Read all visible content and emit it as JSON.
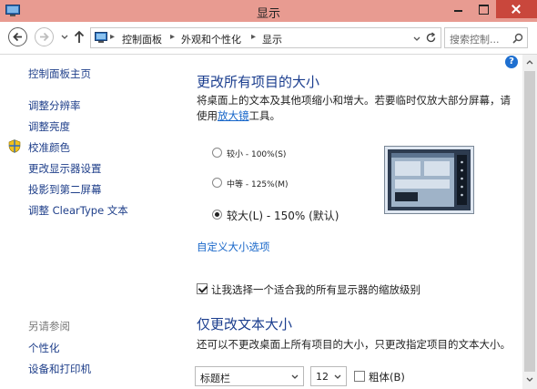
{
  "window": {
    "title": "显示"
  },
  "nav": {
    "breadcrumbs": [
      "控制面板",
      "外观和个性化",
      "显示"
    ],
    "search_placeholder": "搜索控制...",
    "icons": [
      "back-arrow-icon",
      "forward-arrow-icon",
      "chevron-down-icon",
      "up-arrow-icon",
      "refresh-icon",
      "search-icon"
    ]
  },
  "sidebar": {
    "home": "控制面板主页",
    "links": [
      "调整分辨率",
      "调整亮度",
      "校准颜色",
      "更改显示器设置",
      "投影到第二屏幕",
      "调整 ClearType 文本"
    ],
    "see_also_heading": "另请参阅",
    "see_also": [
      "个性化",
      "设备和打印机"
    ]
  },
  "main": {
    "heading": "更改所有项目的大小",
    "desc_line1": "将桌面上的文本及其他项缩小和增大。若要临时仅放大部分屏幕，请",
    "desc_prefix": "使用",
    "desc_link": "放大镜",
    "desc_suffix": "工具。",
    "options": [
      {
        "label": "较小 - 100%(S)",
        "checked": false
      },
      {
        "label": "中等 - 125%(M)",
        "checked": false
      },
      {
        "label": "较大(L) - 150% (默认)",
        "checked": true
      }
    ],
    "custom_link": "自定义大小选项",
    "scale_checkbox": {
      "label": "让我选择一个适合我的所有显示器的缩放级别",
      "checked": true
    },
    "text_heading": "仅更改文本大小",
    "text_desc": "还可以不更改桌面上所有项目的大小，只更改指定项目的文本大小。",
    "item_select": "标题栏",
    "size_select": "12",
    "bold_checkbox": {
      "label": "粗体(B)",
      "checked": false
    }
  },
  "colors": {
    "titlebar": "#e89b91",
    "close_button": "#c9473c",
    "heading": "#1a3d8e",
    "link": "#1766c9"
  }
}
